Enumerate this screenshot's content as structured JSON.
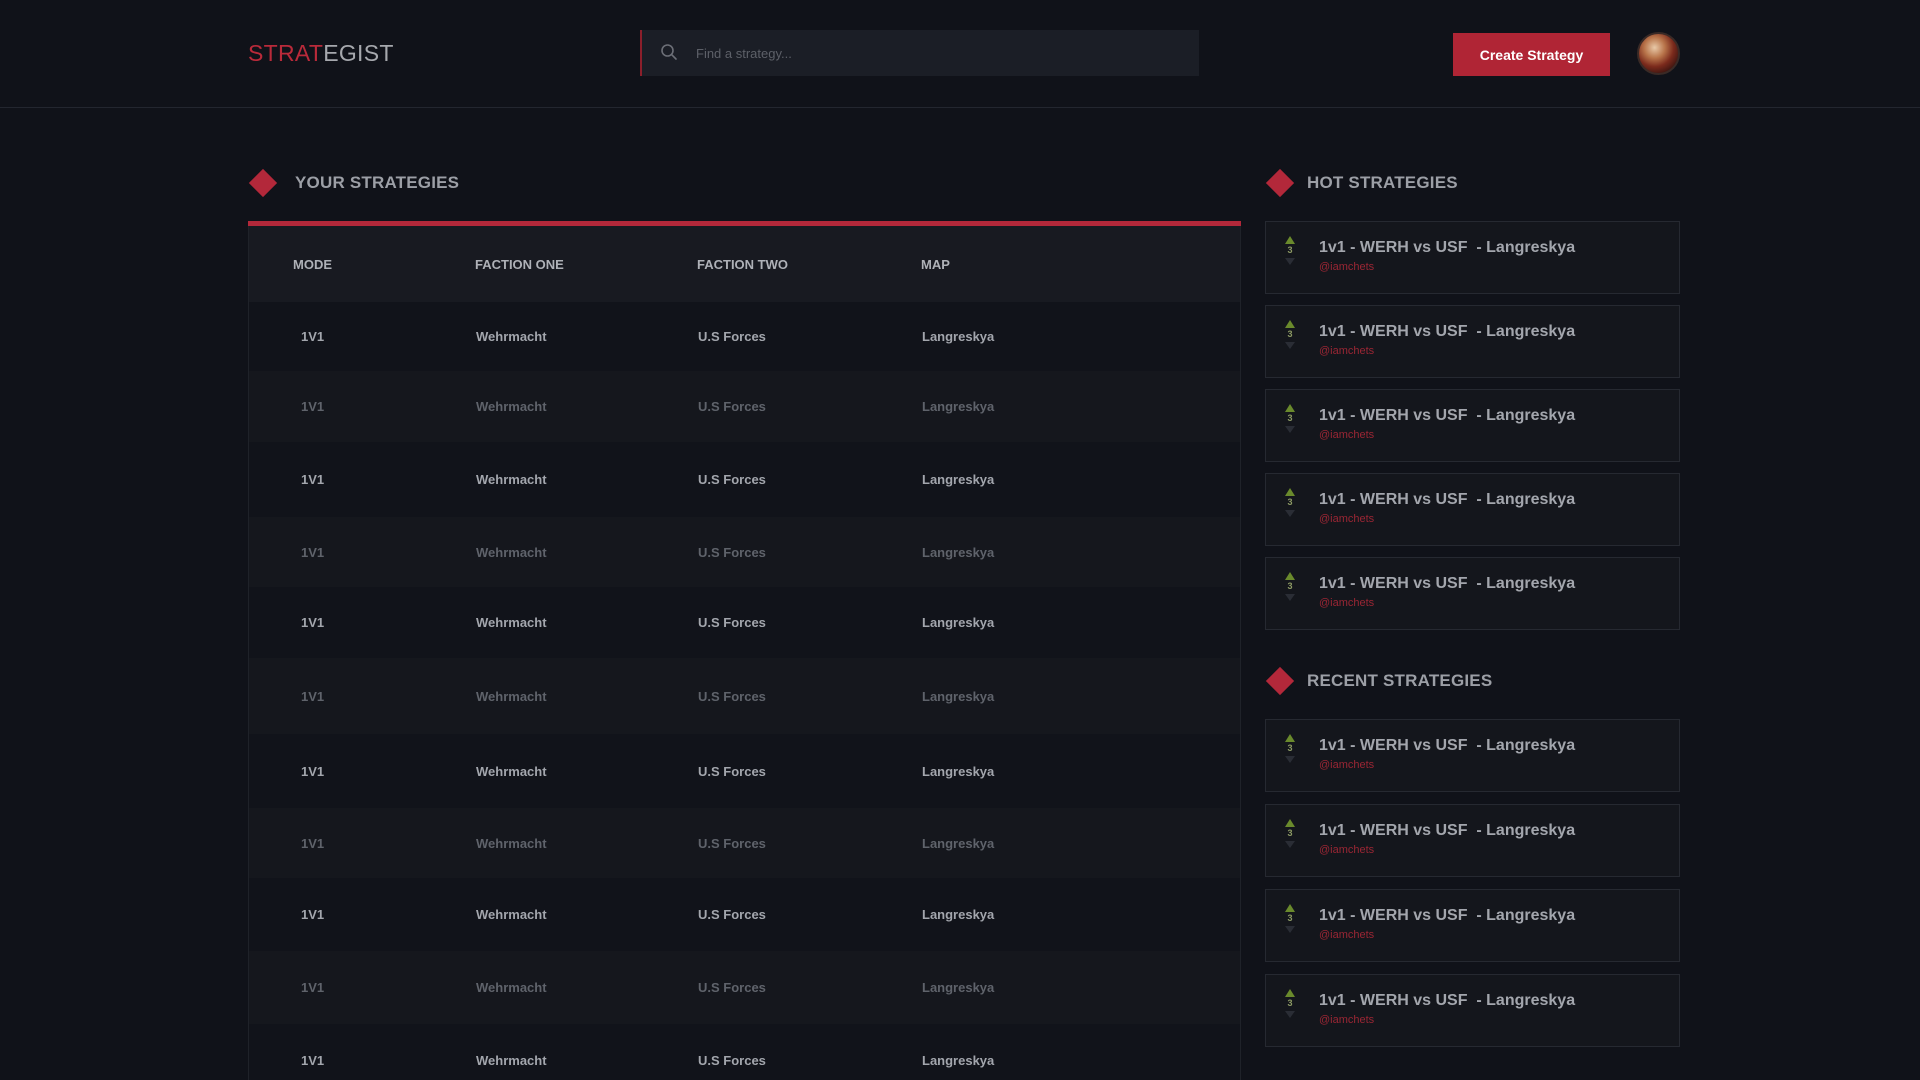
{
  "header": {
    "logo_part1": "STRAT",
    "logo_part2": "EGIST",
    "search_placeholder": "Find a strategy...",
    "create_button": "Create Strategy"
  },
  "your_strategies": {
    "title": "YOUR STRATEGIES",
    "columns": [
      "MODE",
      "FACTION ONE",
      "FACTION TWO",
      "MAP"
    ],
    "rows": [
      {
        "mode": "1V1",
        "faction_one": "Wehrmacht",
        "faction_two": "U.S Forces",
        "map": "Langreskya"
      },
      {
        "mode": "1V1",
        "faction_one": "Wehrmacht",
        "faction_two": "U.S Forces",
        "map": "Langreskya"
      },
      {
        "mode": "1V1",
        "faction_one": "Wehrmacht",
        "faction_two": "U.S Forces",
        "map": "Langreskya"
      },
      {
        "mode": "1V1",
        "faction_one": "Wehrmacht",
        "faction_two": "U.S Forces",
        "map": "Langreskya"
      },
      {
        "mode": "1V1",
        "faction_one": "Wehrmacht",
        "faction_two": "U.S Forces",
        "map": "Langreskya"
      },
      {
        "mode": "1V1",
        "faction_one": "Wehrmacht",
        "faction_two": "U.S Forces",
        "map": "Langreskya"
      },
      {
        "mode": "1V1",
        "faction_one": "Wehrmacht",
        "faction_two": "U.S Forces",
        "map": "Langreskya"
      },
      {
        "mode": "1V1",
        "faction_one": "Wehrmacht",
        "faction_two": "U.S Forces",
        "map": "Langreskya"
      },
      {
        "mode": "1V1",
        "faction_one": "Wehrmacht",
        "faction_two": "U.S Forces",
        "map": "Langreskya"
      },
      {
        "mode": "1V1",
        "faction_one": "Wehrmacht",
        "faction_two": "U.S Forces",
        "map": "Langreskya"
      },
      {
        "mode": "1V1",
        "faction_one": "Wehrmacht",
        "faction_two": "U.S Forces",
        "map": "Langreskya"
      }
    ]
  },
  "hot_strategies": {
    "title": "HOT STRATEGIES",
    "items": [
      {
        "title": "1v1 - WERH vs USF  - Langreskya",
        "author": "@iamchets",
        "votes": "3"
      },
      {
        "title": "1v1 - WERH vs USF  - Langreskya",
        "author": "@iamchets",
        "votes": "3"
      },
      {
        "title": "1v1 - WERH vs USF  - Langreskya",
        "author": "@iamchets",
        "votes": "3"
      },
      {
        "title": "1v1 - WERH vs USF  - Langreskya",
        "author": "@iamchets",
        "votes": "3"
      },
      {
        "title": "1v1 - WERH vs USF  - Langreskya",
        "author": "@iamchets",
        "votes": "3"
      }
    ]
  },
  "recent_strategies": {
    "title": "RECENT STRATEGIES",
    "items": [
      {
        "title": "1v1 - WERH vs USF  - Langreskya",
        "author": "@iamchets",
        "votes": "3"
      },
      {
        "title": "1v1 - WERH vs USF  - Langreskya",
        "author": "@iamchets",
        "votes": "3"
      },
      {
        "title": "1v1 - WERH vs USF  - Langreskya",
        "author": "@iamchets",
        "votes": "3"
      },
      {
        "title": "1v1 - WERH vs USF  - Langreskya",
        "author": "@iamchets",
        "votes": "3"
      }
    ]
  },
  "colors": {
    "accent": "#b3283a",
    "background": "#101219",
    "upvote": "#6a8a2c"
  }
}
